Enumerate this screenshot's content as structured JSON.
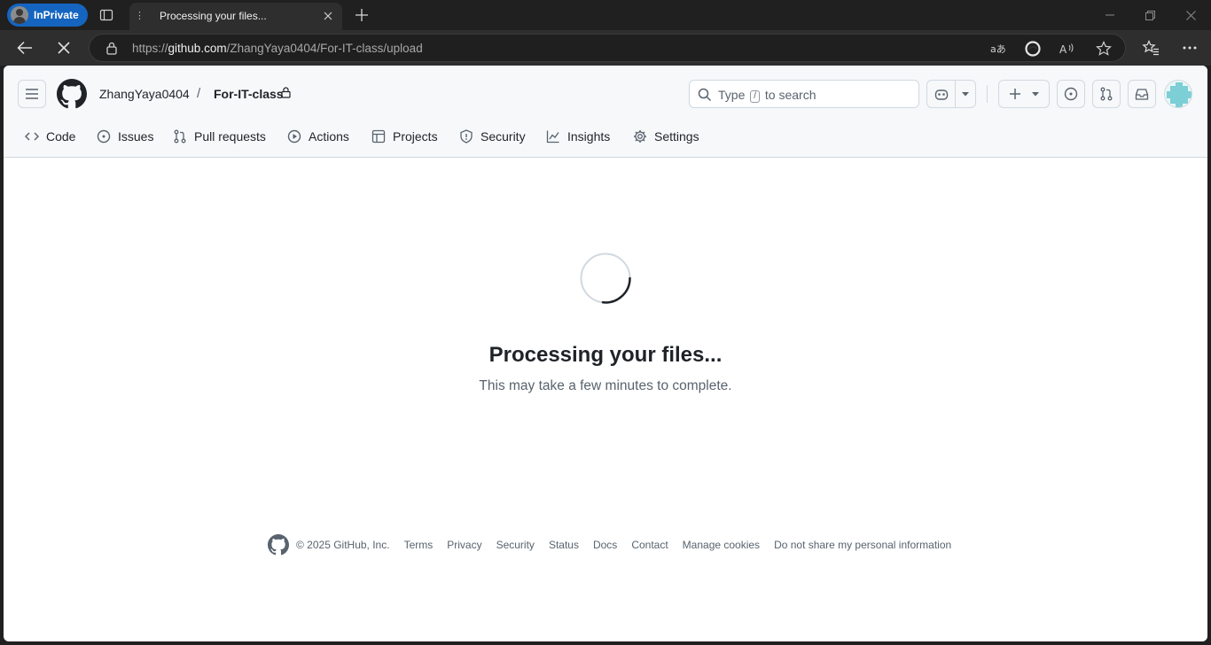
{
  "browser": {
    "inprivate_label": "InPrivate",
    "tab_title": "Processing your files...",
    "url_prefix": "https://",
    "url_host": "github.com",
    "url_path": "/ZhangYaya0404/For-IT-class/upload"
  },
  "header": {
    "owner": "ZhangYaya0404",
    "separator": "/",
    "repo": "For-IT-class",
    "search_prefix": "Type",
    "search_key": "/",
    "search_suffix": "to search"
  },
  "repo_nav": [
    {
      "label": "Code",
      "icon": "code-icon"
    },
    {
      "label": "Issues",
      "icon": "issue-opened-icon"
    },
    {
      "label": "Pull requests",
      "icon": "git-pull-request-icon"
    },
    {
      "label": "Actions",
      "icon": "play-icon"
    },
    {
      "label": "Projects",
      "icon": "table-icon"
    },
    {
      "label": "Security",
      "icon": "shield-icon"
    },
    {
      "label": "Insights",
      "icon": "graph-icon"
    },
    {
      "label": "Settings",
      "icon": "gear-icon"
    }
  ],
  "main": {
    "title": "Processing your files...",
    "subtitle": "This may take a few minutes to complete."
  },
  "footer": {
    "copyright": "© 2025 GitHub, Inc.",
    "links": [
      "Terms",
      "Privacy",
      "Security",
      "Status",
      "Docs",
      "Contact",
      "Manage cookies",
      "Do not share my personal information"
    ]
  },
  "colors": {
    "browser_bg": "#202020",
    "inprivate_blue": "#1565c0",
    "header_bg": "#f6f8fa",
    "text": "#1f2328",
    "muted": "#59636e",
    "border": "#d1d9e0"
  }
}
